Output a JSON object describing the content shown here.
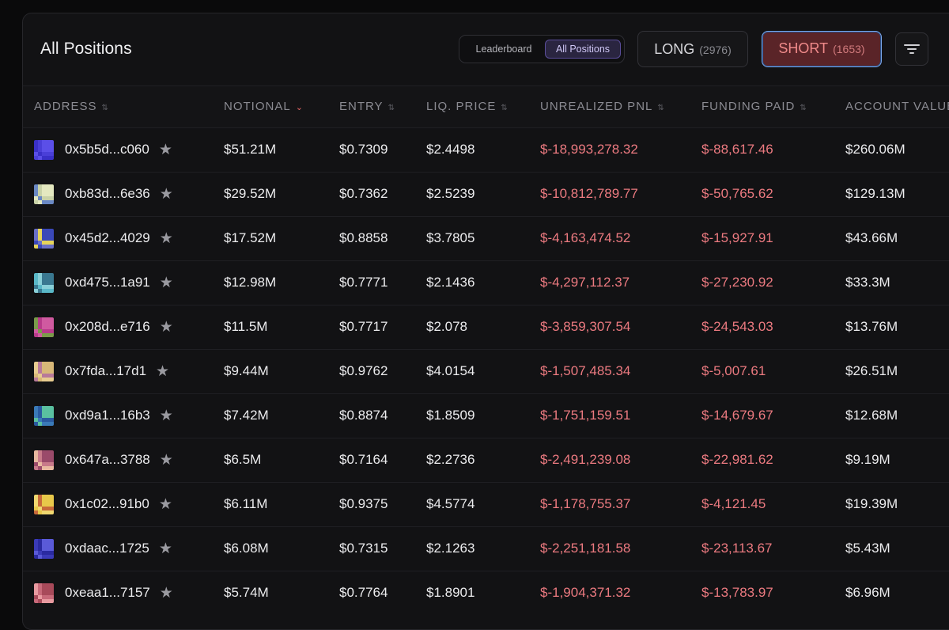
{
  "header": {
    "title": "All Positions",
    "segment": {
      "leaderboard": "Leaderboard",
      "all_positions": "All Positions"
    },
    "long": {
      "label": "LONG",
      "count": "(2976)"
    },
    "short": {
      "label": "SHORT",
      "count": "(1653)"
    },
    "filter_icon": "filter-icon"
  },
  "columns": [
    "ADDRESS",
    "NOTIONAL",
    "ENTRY",
    "LIQ. PRICE",
    "UNREALIZED PNL",
    "FUNDING PAID",
    "ACCOUNT VALUE"
  ],
  "rows": [
    {
      "address": "0x5b5d...c060",
      "notional": "$51.21M",
      "entry": "$0.7309",
      "liq": "$2.4498",
      "pnl": "$-18,993,278.32",
      "funding": "$-88,617.46",
      "account": "$260.06M",
      "avatar": [
        "#3a30c8",
        "#5b4fe8",
        "#4a3fd8"
      ]
    },
    {
      "address": "0xb83d...6e36",
      "notional": "$29.52M",
      "entry": "$0.7362",
      "liq": "$2.5239",
      "pnl": "$-10,812,789.77",
      "funding": "$-50,765.62",
      "account": "$129.13M",
      "avatar": [
        "#c9d2a8",
        "#6a88c4",
        "#e4e8c0"
      ]
    },
    {
      "address": "0x45d2...4029",
      "notional": "$17.52M",
      "entry": "$0.8858",
      "liq": "$3.7805",
      "pnl": "$-4,163,474.52",
      "funding": "$-15,927.91",
      "account": "$43.66M",
      "avatar": [
        "#3a48b8",
        "#e6d45a",
        "#6a70c8"
      ]
    },
    {
      "address": "0xd475...1a91",
      "notional": "$12.98M",
      "entry": "$0.7771",
      "liq": "$2.1436",
      "pnl": "$-4,297,112.37",
      "funding": "$-27,230.92",
      "account": "$33.3M",
      "avatar": [
        "#5ab8c8",
        "#3a7890",
        "#8ad0d8"
      ]
    },
    {
      "address": "0x208d...e716",
      "notional": "$11.5M",
      "entry": "$0.7717",
      "liq": "$2.078",
      "pnl": "$-3,859,307.54",
      "funding": "$-24,543.03",
      "account": "$13.76M",
      "avatar": [
        "#b83a8a",
        "#7a9a4a",
        "#d05aa0"
      ]
    },
    {
      "address": "0x7fda...17d1",
      "notional": "$9.44M",
      "entry": "$0.9762",
      "liq": "$4.0154",
      "pnl": "$-1,507,485.34",
      "funding": "$-5,007.61",
      "account": "$26.51M",
      "avatar": [
        "#d8b878",
        "#b87a9a",
        "#e8cc90"
      ]
    },
    {
      "address": "0xd9a1...16b3",
      "notional": "$7.42M",
      "entry": "$0.8874",
      "liq": "$1.8509",
      "pnl": "$-1,751,159.51",
      "funding": "$-14,679.67",
      "account": "$12.68M",
      "avatar": [
        "#3a7ab8",
        "#5ac0a0",
        "#2a5aa0"
      ]
    },
    {
      "address": "0x647a...3788",
      "notional": "$6.5M",
      "entry": "$0.7164",
      "liq": "$2.2736",
      "pnl": "$-2,491,239.08",
      "funding": "$-22,981.62",
      "account": "$9.19M",
      "avatar": [
        "#c87a8a",
        "#e8b8a0",
        "#9a4a6a"
      ]
    },
    {
      "address": "0x1c02...91b0",
      "notional": "$6.11M",
      "entry": "$0.9375",
      "liq": "$4.5774",
      "pnl": "$-1,178,755.37",
      "funding": "$-4,121.45",
      "account": "$19.39M",
      "avatar": [
        "#e8c84a",
        "#c86a3a",
        "#f0d870"
      ]
    },
    {
      "address": "0xdaac...1725",
      "notional": "$6.08M",
      "entry": "$0.7315",
      "liq": "$2.1263",
      "pnl": "$-2,251,181.58",
      "funding": "$-23,113.67",
      "account": "$5.43M",
      "avatar": [
        "#3a3ab8",
        "#5a5ad8",
        "#2a2aa0"
      ]
    },
    {
      "address": "0xeaa1...7157",
      "notional": "$5.74M",
      "entry": "$0.7764",
      "liq": "$1.8901",
      "pnl": "$-1,904,371.32",
      "funding": "$-13,783.97",
      "account": "$6.96M",
      "avatar": [
        "#c86a7a",
        "#e89aa0",
        "#a84a5a"
      ]
    }
  ],
  "colors": {
    "negative": "#ec7a80",
    "accent_purple": "#5a4d9a",
    "short_bg": "#5a2428",
    "short_border": "#7aa8ec"
  }
}
